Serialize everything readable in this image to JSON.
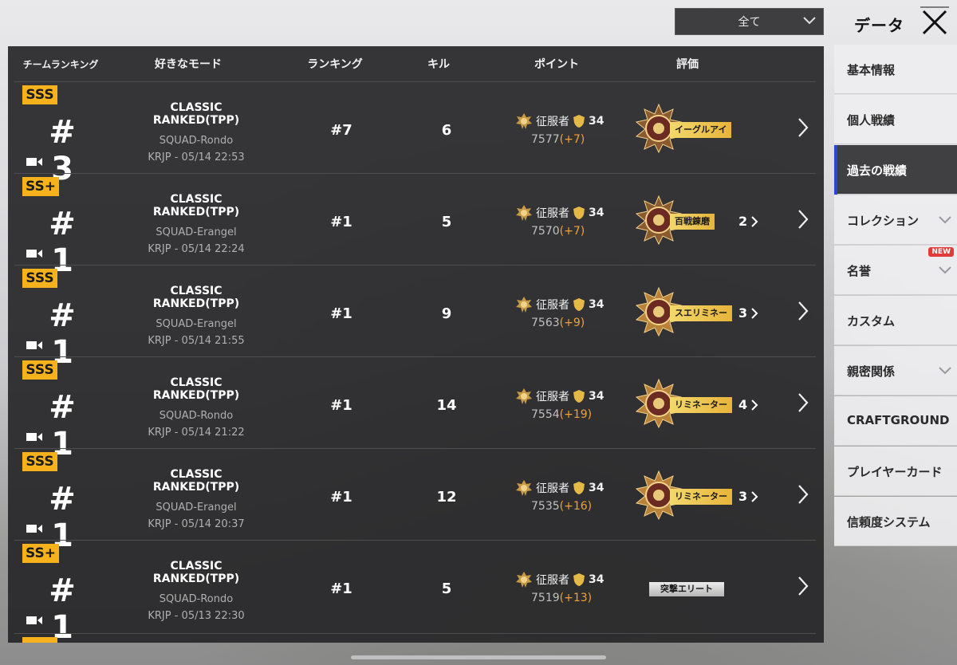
{
  "filter": {
    "label": "全て"
  },
  "title": "データ",
  "table": {
    "headers": {
      "team_rank": "チームランキング",
      "mode": "好きなモード",
      "ranking": "ランキング",
      "kills": "キル",
      "points": "ポイント",
      "evaluation": "評価"
    },
    "rows": [
      {
        "grade": "SSS",
        "team_rank": "# 3",
        "mode": "CLASSIC RANKED(TPP)",
        "sub": "SQUAD-Rondo",
        "date": "KRJP - 05/14 22:53",
        "ranking": "#7",
        "kills": "6",
        "tier": "征服者",
        "level": "34",
        "points": "7577",
        "delta": "(+7)",
        "eval_tag": "イーグルアイ",
        "eval_count": ""
      },
      {
        "grade": "SS+",
        "team_rank": "# 1",
        "mode": "CLASSIC RANKED(TPP)",
        "sub": "SQUAD-Erangel",
        "date": "KRJP - 05/14 22:24",
        "ranking": "#1",
        "kills": "5",
        "tier": "征服者",
        "level": "34",
        "points": "7570",
        "delta": "(+7)",
        "eval_tag": "百戦錬磨",
        "eval_count": "2"
      },
      {
        "grade": "SSS",
        "team_rank": "# 1",
        "mode": "CLASSIC RANKED(TPP)",
        "sub": "SQUAD-Erangel",
        "date": "KRJP - 05/14 21:55",
        "ranking": "#1",
        "kills": "9",
        "tier": "征服者",
        "level": "34",
        "points": "7563",
        "delta": "(+9)",
        "eval_tag": "スエリミネー",
        "eval_count": "3"
      },
      {
        "grade": "SSS",
        "team_rank": "# 1",
        "mode": "CLASSIC RANKED(TPP)",
        "sub": "SQUAD-Rondo",
        "date": "KRJP - 05/14 21:22",
        "ranking": "#1",
        "kills": "14",
        "tier": "征服者",
        "level": "34",
        "points": "7554",
        "delta": "(+19)",
        "eval_tag": "リミネーター",
        "eval_count": "4"
      },
      {
        "grade": "SSS",
        "team_rank": "# 1",
        "mode": "CLASSIC RANKED(TPP)",
        "sub": "SQUAD-Erangel",
        "date": "KRJP - 05/14 20:37",
        "ranking": "#1",
        "kills": "12",
        "tier": "征服者",
        "level": "34",
        "points": "7535",
        "delta": "(+16)",
        "eval_tag": "リミネーター",
        "eval_count": "3"
      },
      {
        "grade": "SS+",
        "team_rank": "# 1",
        "mode": "CLASSIC RANKED(TPP)",
        "sub": "SQUAD-Rondo",
        "date": "KRJP - 05/13 22:30",
        "ranking": "#1",
        "kills": "5",
        "tier": "征服者",
        "level": "34",
        "points": "7519",
        "delta": "(+13)",
        "eval_plain": "突撃エリート"
      }
    ]
  },
  "sidebar": {
    "items": [
      {
        "label": "基本情報"
      },
      {
        "label": "個人戦績"
      },
      {
        "label": "過去の戦績"
      },
      {
        "label": "コレクション"
      },
      {
        "label": "名誉",
        "badge": "NEW"
      },
      {
        "label": "カスタム"
      },
      {
        "label": "親密関係"
      },
      {
        "label": "CRAFTGROUND"
      },
      {
        "label": "プレイヤーカード"
      },
      {
        "label": "信頼度システム"
      }
    ]
  },
  "colors": {
    "accent": "#2a46d8",
    "grade": "#f5b21c",
    "delta": "#f0a23a",
    "gold_tag": "#e7b43a"
  }
}
